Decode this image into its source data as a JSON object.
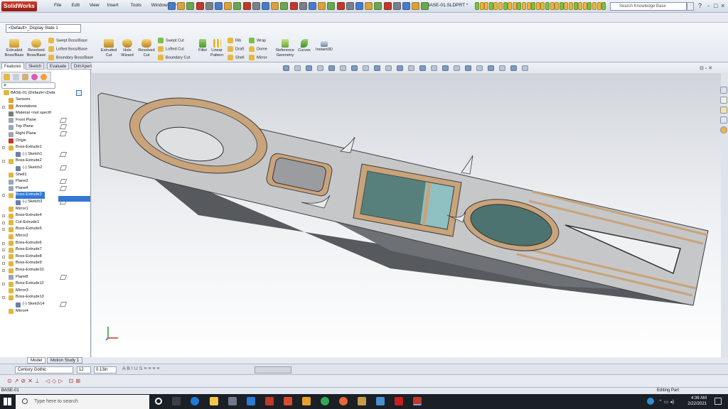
{
  "app": {
    "name": "SolidWorks",
    "document_title": "BASE-01.SLDPRT *"
  },
  "menu": [
    "File",
    "Edit",
    "View",
    "Insert",
    "Tools",
    "Window",
    "Help"
  ],
  "search": {
    "placeholder": "Search Knowledge Base"
  },
  "window_controls": [
    "?",
    "-",
    "□",
    "×"
  ],
  "config_dropdown": "<Default>_Display State 1",
  "features_toolbar": {
    "extruded_boss": "Extruded\nBoss/Base",
    "revolved_boss": "Revolved\nBoss/Base",
    "swept_boss": "Swept Boss/Base",
    "lofted_boss": "Lofted Boss/Base",
    "boundary_boss": "Boundary Boss/Base",
    "extruded_cut": "Extruded\nCut",
    "hole_wizard": "Hole\nWizard",
    "revolved_cut": "Revolved\nCut",
    "swept_cut": "Swept Cut",
    "lofted_cut": "Lofted Cut",
    "boundary_cut": "Boundary Cut",
    "fillet": "Fillet",
    "linear_pattern": "Linear\nPattern",
    "rib": "Rib",
    "draft": "Draft",
    "shell": "Shell",
    "wrap": "Wrap",
    "dome": "Dome",
    "mirror": "Mirror",
    "reference_geometry": "Reference\nGeometry",
    "curves": "Curves",
    "instant3d": "Instant3D"
  },
  "command_tabs": [
    "Features",
    "Sketch",
    "Evaluate",
    "DimXpert"
  ],
  "tree": {
    "root": "BASE-01  (Default<<Defa",
    "items": [
      {
        "label": "Sensors",
        "indent": 1,
        "color": "#d8a43a"
      },
      {
        "label": "Annotations",
        "indent": 1,
        "color": "#d8a43a",
        "expand": true
      },
      {
        "label": "Material <not specifi",
        "indent": 1,
        "color": "#7c7c7c"
      },
      {
        "label": "Front Plane",
        "indent": 1,
        "color": "#9aa6b8"
      },
      {
        "label": "Top Plane",
        "indent": 1,
        "color": "#9aa6b8"
      },
      {
        "label": "Right Plane",
        "indent": 1,
        "color": "#9aa6b8"
      },
      {
        "label": "Origin",
        "indent": 1,
        "color": "#c0392b"
      },
      {
        "label": "Boss-Extrude1",
        "indent": 1,
        "color": "#e2b63e",
        "expand": true
      },
      {
        "label": "(-) Sketch1",
        "indent": 2,
        "color": "#6b7fa8"
      },
      {
        "label": "Boss-Extrude2",
        "indent": 1,
        "color": "#e2b63e",
        "expand": true
      },
      {
        "label": "(-) Sketch2",
        "indent": 2,
        "color": "#6b7fa8"
      },
      {
        "label": "Shell1",
        "indent": 1,
        "color": "#e2b63e"
      },
      {
        "label": "Plane3",
        "indent": 1,
        "color": "#9aa6b8"
      },
      {
        "label": "Plane4",
        "indent": 1,
        "color": "#9aa6b8"
      },
      {
        "label": "Boss-Extrude3",
        "indent": 1,
        "color": "#e2b63e",
        "expand": true,
        "selected": true
      },
      {
        "label": "(-) Sketch3",
        "indent": 2,
        "color": "#6b7fa8"
      },
      {
        "label": "Mirror1",
        "indent": 1,
        "color": "#e2b63e"
      },
      {
        "label": "Boss-Extrude4",
        "indent": 1,
        "color": "#e2b63e",
        "expand": true
      },
      {
        "label": "Cut-Extrude1",
        "indent": 1,
        "color": "#e2b63e",
        "expand": true
      },
      {
        "label": "Boss-Extrude5",
        "indent": 1,
        "color": "#e2b63e",
        "expand": true
      },
      {
        "label": "Mirror2",
        "indent": 1,
        "color": "#e2b63e"
      },
      {
        "label": "Boss-Extrude6",
        "indent": 1,
        "color": "#e2b63e",
        "expand": true
      },
      {
        "label": "Boss-Extrude7",
        "indent": 1,
        "color": "#e2b63e",
        "expand": true
      },
      {
        "label": "Boss-Extrude8",
        "indent": 1,
        "color": "#e2b63e",
        "expand": true
      },
      {
        "label": "Boss-Extrude9",
        "indent": 1,
        "color": "#e2b63e",
        "expand": true
      },
      {
        "label": "Boss-Extrude10",
        "indent": 1,
        "color": "#e2b63e",
        "expand": true
      },
      {
        "label": "Plane8",
        "indent": 1,
        "color": "#9aa6b8"
      },
      {
        "label": "Boss-Extrude12",
        "indent": 1,
        "color": "#e2b63e",
        "expand": true
      },
      {
        "label": "Mirror3",
        "indent": 1,
        "color": "#e2b63e"
      },
      {
        "label": "Boss-Extrude13",
        "indent": 1,
        "color": "#e2b63e",
        "expand": true
      },
      {
        "label": "(-) Sketch14",
        "indent": 2,
        "color": "#6b7fa8"
      },
      {
        "label": "Mirror4",
        "indent": 1,
        "color": "#e2b63e"
      }
    ]
  },
  "bottom_tabs": [
    "Model",
    "Motion Study 1"
  ],
  "format_bar": {
    "font": "Century Gothic",
    "size": "12",
    "linewidth": "0.13in"
  },
  "status": {
    "left": "BASE-01",
    "right": "Editing Part"
  },
  "taskbar": {
    "search_placeholder": "Type here to search",
    "time": "4:36 AM",
    "date": "2/22/2021"
  },
  "colors": {
    "selection": "#3478d4",
    "taskbar": "#1b1f26",
    "model_gray": "#c6c7c8",
    "model_wood": "#c9a37a",
    "model_teal": "#4d7370"
  }
}
